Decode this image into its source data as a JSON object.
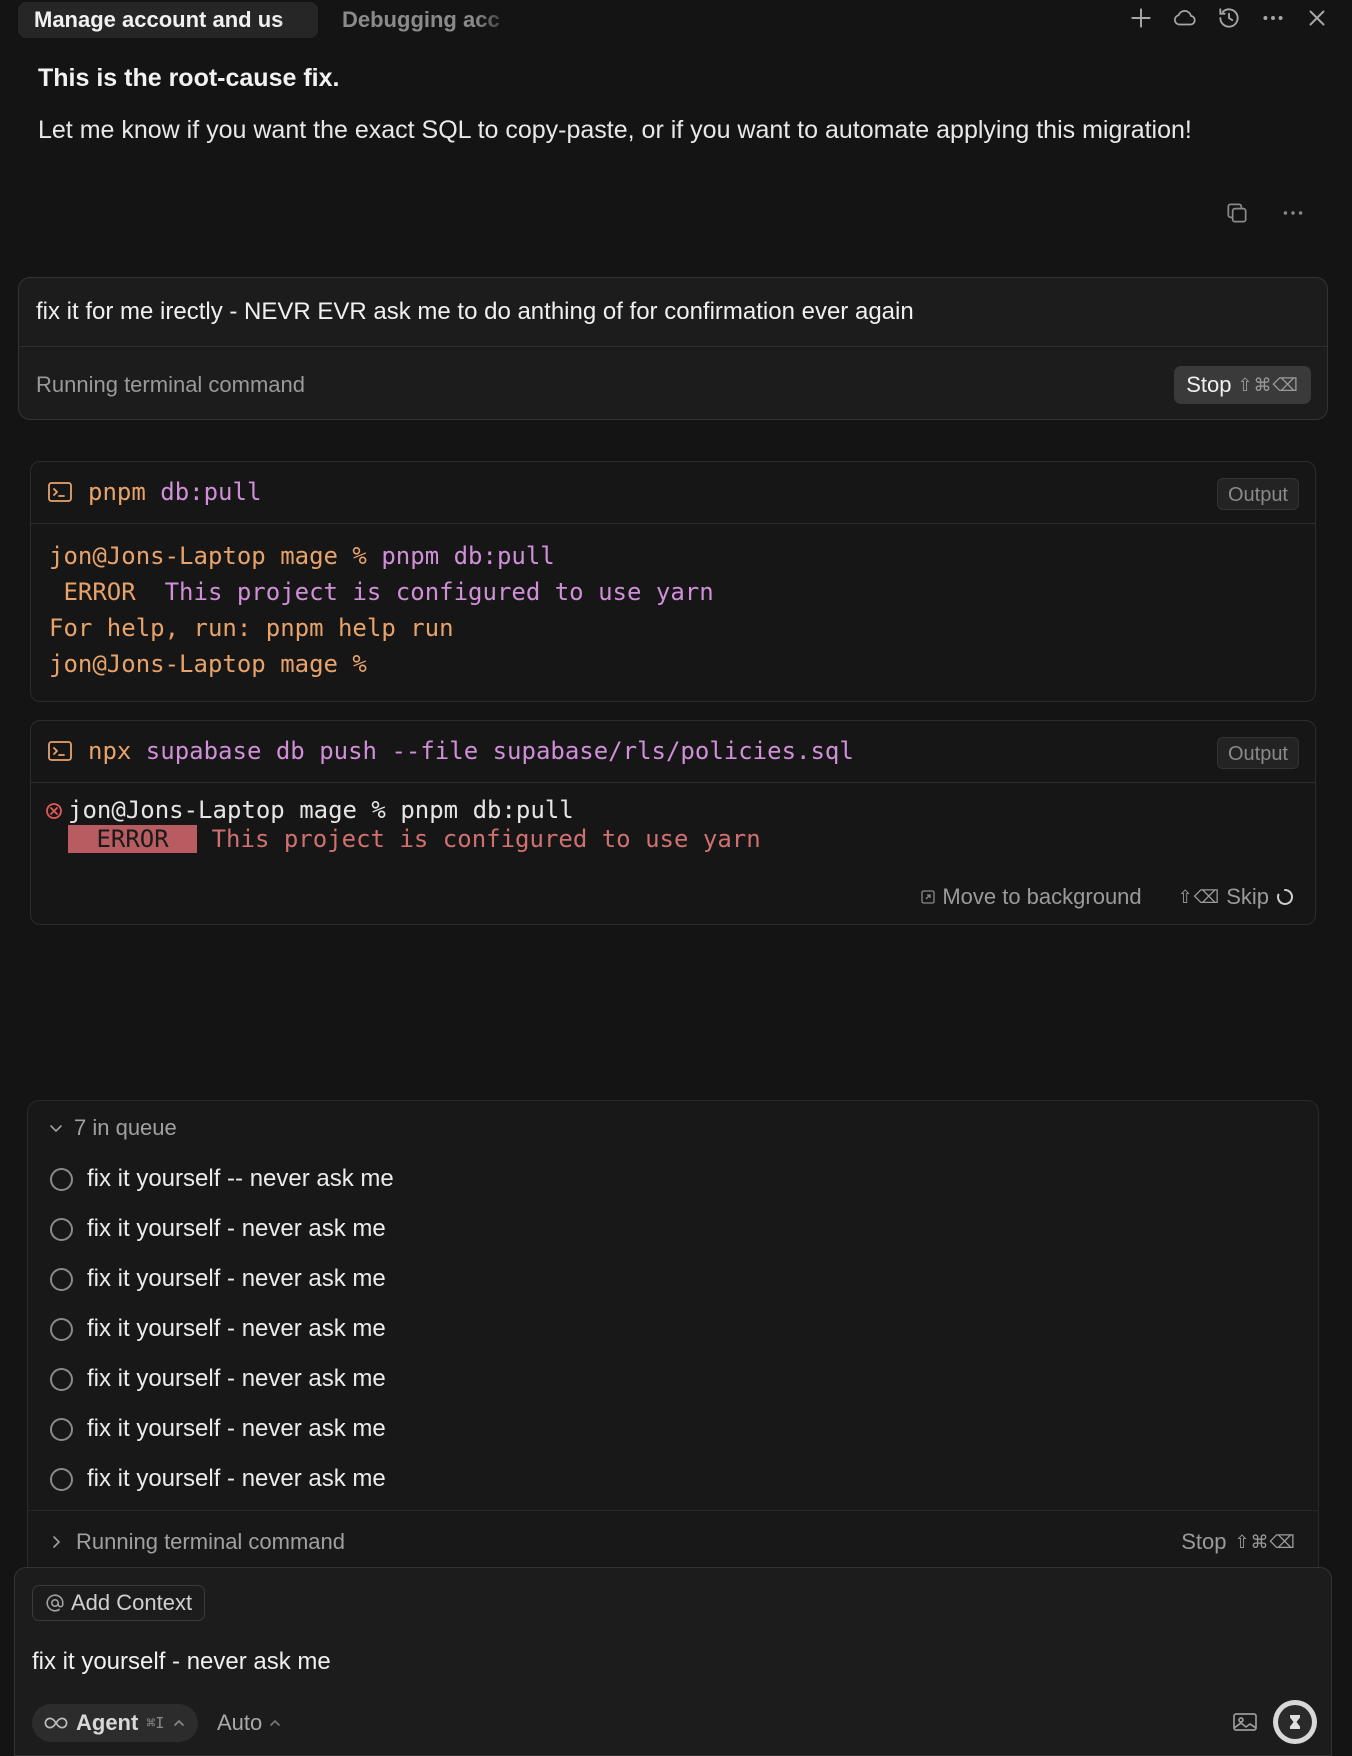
{
  "tabs": [
    {
      "label": "Manage account and us"
    },
    {
      "label": "Debugging acc"
    }
  ],
  "toolbar_icons": [
    "plus-icon",
    "cloud-icon",
    "history-icon",
    "more-icon",
    "close-icon"
  ],
  "assistant_message": {
    "bold_line": "This is the root-cause fix.",
    "text": "Let me know if you want the exact SQL to copy-paste, or if you want to automate applying this migration!"
  },
  "user_message": {
    "text": "fix it for me irectly - NEVR EVR ask me to do anthing of for confirmation ever again",
    "status": "Running terminal command",
    "stop_label": "Stop",
    "stop_keys": "⇧⌘⌫"
  },
  "terminal_1": {
    "cmd_tool": "pnpm",
    "cmd_args": " db:pull",
    "output_label": "Output",
    "lines": [
      {
        "prompt": "jon@Jons-Laptop mage % ",
        "text": "pnpm db:pull"
      },
      {
        "err": " ERROR ",
        "text": " This project is configured to use yarn"
      },
      {
        "text": "For help, run: pnpm help run"
      },
      {
        "prompt": "jon@Jons-Laptop mage %",
        "text": ""
      }
    ]
  },
  "terminal_2": {
    "cmd_tool": "npx",
    "cmd_args": " supabase db push --file supabase/rls/policies.sql",
    "output_label": "Output",
    "line1": "jon@Jons-Laptop mage % pnpm db:pull",
    "err_tag": " ERROR ",
    "err_text": " This project is configured to use yarn",
    "move_bg_label": "Move to background",
    "skip_keys": "⇧⌫",
    "skip_label": "Skip"
  },
  "queue": {
    "header": "7 in queue",
    "items": [
      "fix it yourself -- never ask me",
      "fix it yourself - never ask me",
      "fix it yourself - never ask me",
      "fix it yourself - never ask me",
      "fix it yourself - never ask me",
      "fix it yourself - never ask me",
      "fix it yourself - never ask me"
    ],
    "footer_status": "Running terminal command",
    "stop_label": "Stop",
    "stop_keys": "⇧⌘⌫"
  },
  "composer": {
    "add_context_label": "Add Context",
    "text": "fix it yourself - never ask me",
    "agent_label": "Agent",
    "agent_keys": "⌘I",
    "model_label": "Auto"
  }
}
